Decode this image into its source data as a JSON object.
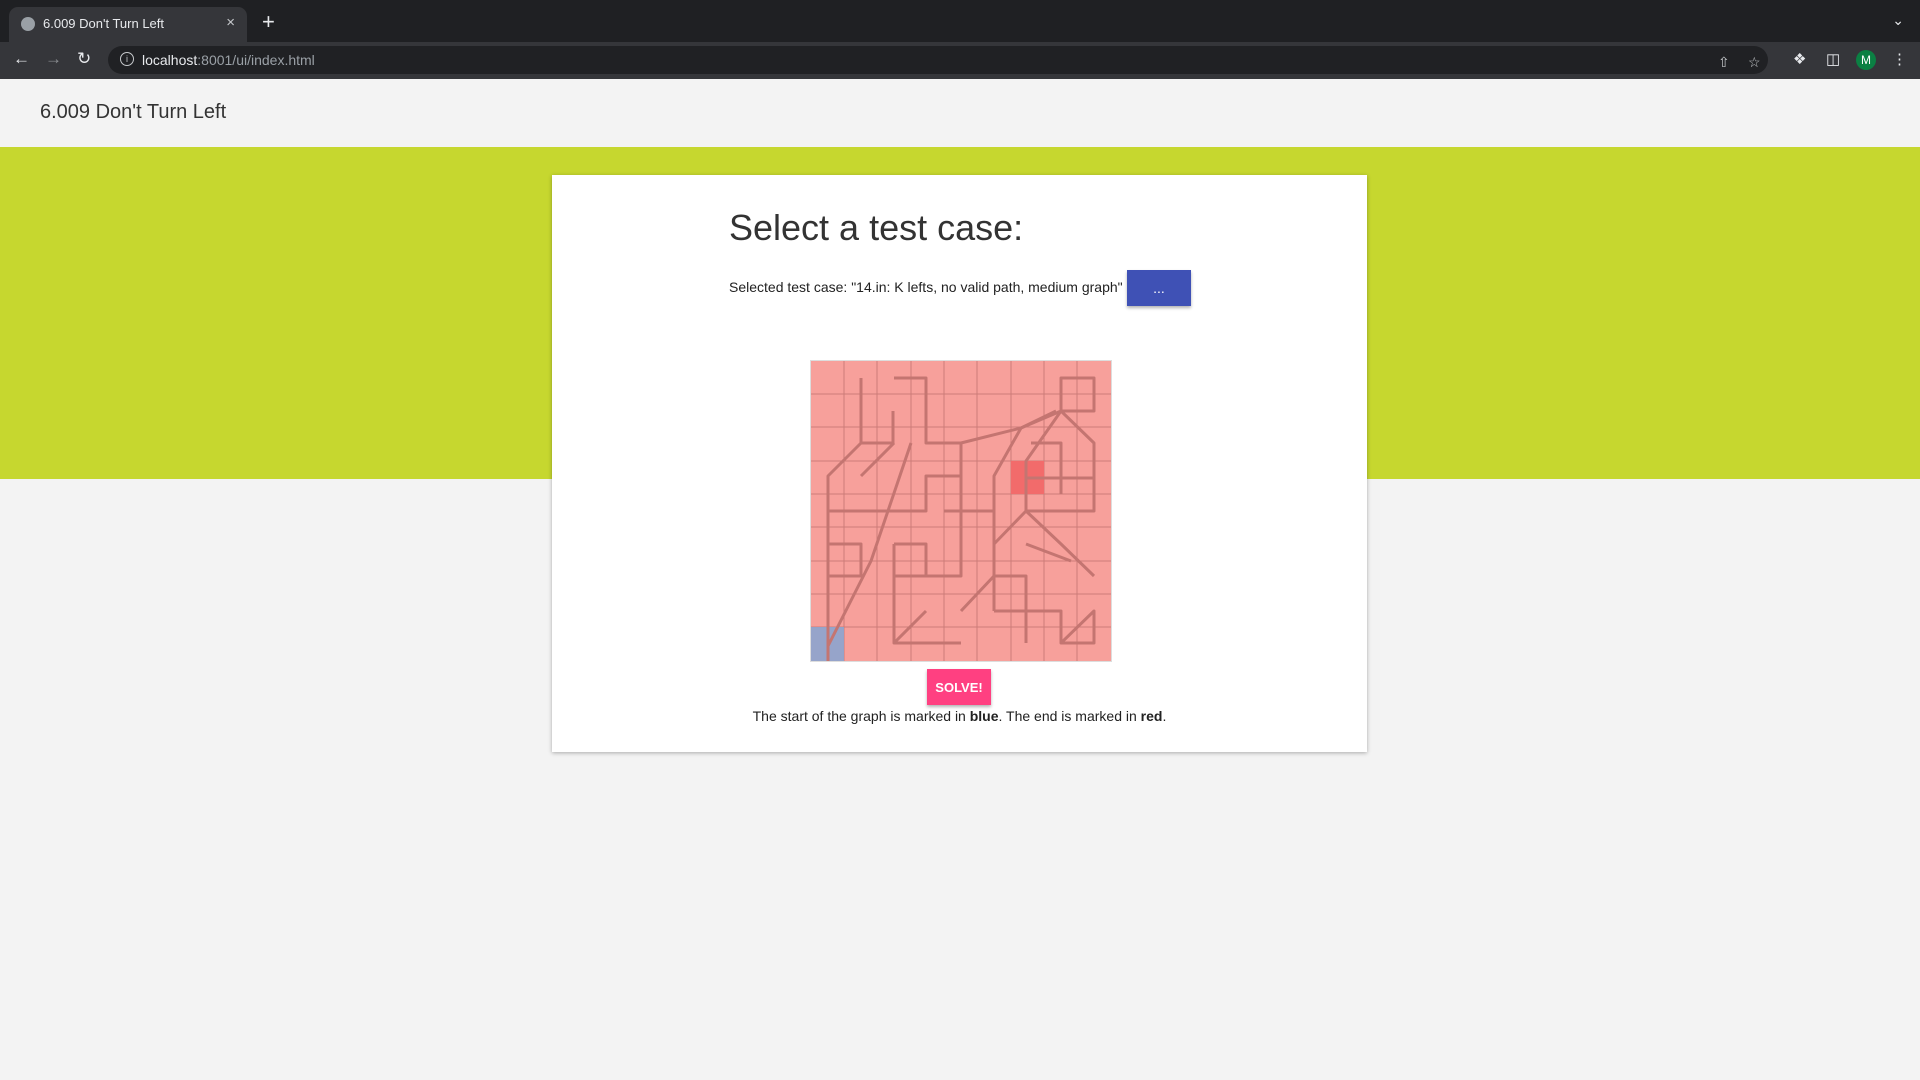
{
  "browser": {
    "tab_title": "6.009 Don't Turn Left",
    "new_tab": "+",
    "close": "×",
    "url_host": "localhost",
    "url_path": ":8001/ui/index.html",
    "profile_initial": "M"
  },
  "app": {
    "title": "6.009 Don't Turn Left"
  },
  "card": {
    "heading": "Select a test case:",
    "selected_prefix": "Selected test case: ",
    "selected_case": "\"14.in: K lefts, no valid path, medium graph\"",
    "more_button": "...",
    "solve_button": "SOLVE!",
    "legend_part1": "The start of the graph is marked in ",
    "legend_blue": "blue",
    "legend_part2": ". The end is marked in ",
    "legend_red": "red",
    "legend_part3": "."
  },
  "colors": {
    "banner": "#c6d72f",
    "grid_fill": "#f7a09b",
    "start": "#8ba4cf",
    "end": "#f26b6b",
    "primary_button": "#3f51b5",
    "accent_button": "#ff4081"
  }
}
